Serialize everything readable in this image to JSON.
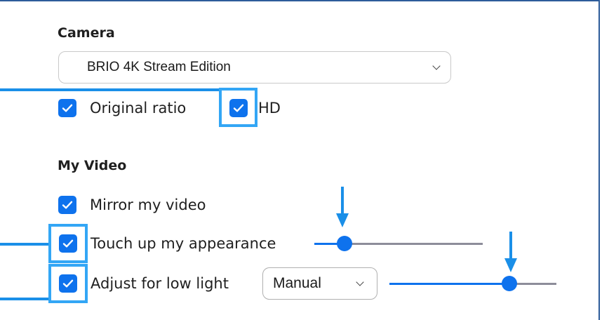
{
  "camera": {
    "heading": "Camera",
    "device_select": {
      "value": "BRIO 4K Stream Edition",
      "icon": "chevron-down-icon"
    },
    "original_ratio": {
      "label": "Original ratio",
      "checked": true
    },
    "hd": {
      "label": "HD",
      "checked": true
    }
  },
  "my_video": {
    "heading": "My Video",
    "mirror": {
      "label": "Mirror my video",
      "checked": true
    },
    "touch_up": {
      "label": "Touch up my appearance",
      "checked": true,
      "slider_level": 0.18
    },
    "low_light": {
      "label": "Adjust for low light",
      "checked": true,
      "mode_select": {
        "value": "Manual",
        "icon": "chevron-down-icon"
      },
      "slider_level": 0.72
    }
  },
  "colors": {
    "accent": "#0e72ed",
    "highlight": "#33a6f5",
    "callout": "#1a8fe8",
    "track": "#8d8d9a"
  }
}
